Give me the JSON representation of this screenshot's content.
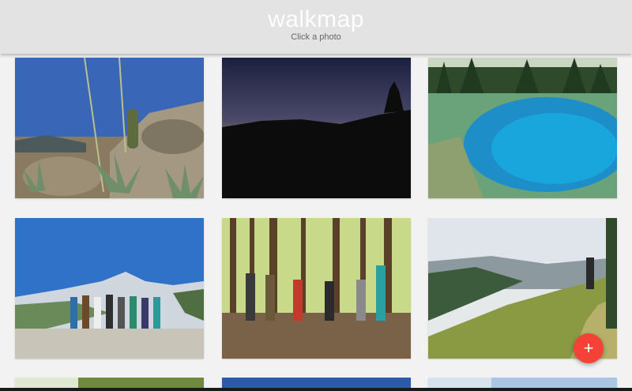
{
  "header": {
    "title": "walkmap",
    "subtitle": "Click a photo"
  },
  "photos": [
    {
      "name": "desert-agave-photo"
    },
    {
      "name": "sunset-silhouette-photo"
    },
    {
      "name": "blue-pool-photo"
    },
    {
      "name": "group-mountain-photo"
    },
    {
      "name": "forest-hikers-photo"
    },
    {
      "name": "ridge-trail-photo"
    },
    {
      "name": "partial-photo-1"
    },
    {
      "name": "partial-photo-2"
    },
    {
      "name": "partial-photo-3"
    }
  ],
  "fab": {
    "icon": "plus-icon",
    "symbol": "+",
    "color": "#f44336"
  },
  "colors": {
    "header_bg": "#e3e3e3",
    "page_bg": "#f2f2f2"
  }
}
